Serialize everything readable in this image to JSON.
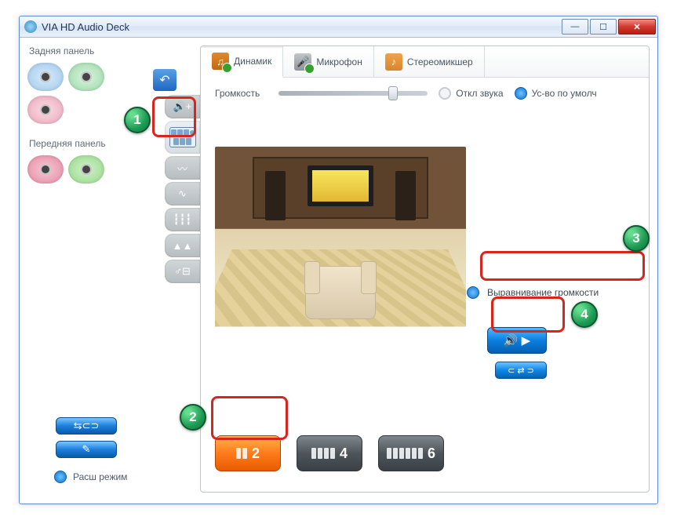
{
  "window": {
    "title": "VIA HD Audio Deck"
  },
  "left": {
    "rear_label": "Задняя панель",
    "front_label": "Передняя панель",
    "adv_mode": "Расш режим"
  },
  "tabs": {
    "speaker": "Динамик",
    "mic": "Микрофон",
    "mixer": "Стереомикшер"
  },
  "volume": {
    "label": "Громкость",
    "mute": "Откл звука",
    "default_device": "Ус-во по умолч"
  },
  "leveling": {
    "label": "Выравнивание громкости"
  },
  "speakers": {
    "opt2": "2",
    "opt4": "4",
    "opt6": "6"
  },
  "markers": {
    "m1": "1",
    "m2": "2",
    "m3": "3",
    "m4": "4"
  }
}
